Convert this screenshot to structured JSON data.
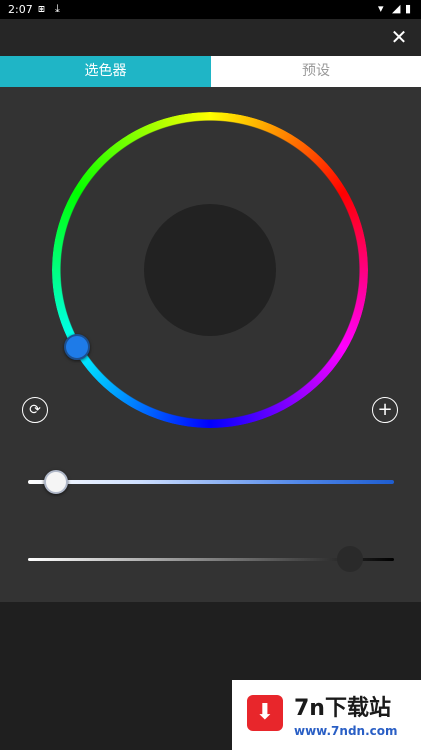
{
  "status": {
    "time": "2:07",
    "icons": [
      "sim-icon",
      "download-icon",
      "wifi-icon",
      "signal-icon",
      "battery-icon"
    ]
  },
  "topbar": {
    "close_glyph": "✕"
  },
  "tabs": [
    {
      "label": "选色器",
      "active": true
    },
    {
      "label": "预设",
      "active": false
    }
  ],
  "picker": {
    "reset_glyph": "⟳",
    "add_glyph": "+",
    "hue_slider_value": 0.07,
    "brightness_slider_value": 0.88
  },
  "watermark": {
    "title": "7n下载站",
    "url": "www.7ndn.com",
    "icon_glyph": "⬇"
  },
  "colors": {
    "accent": "#1fb5c6",
    "panel": "#333333",
    "background": "#1f1f1f",
    "thumb": "#1e7be8"
  }
}
